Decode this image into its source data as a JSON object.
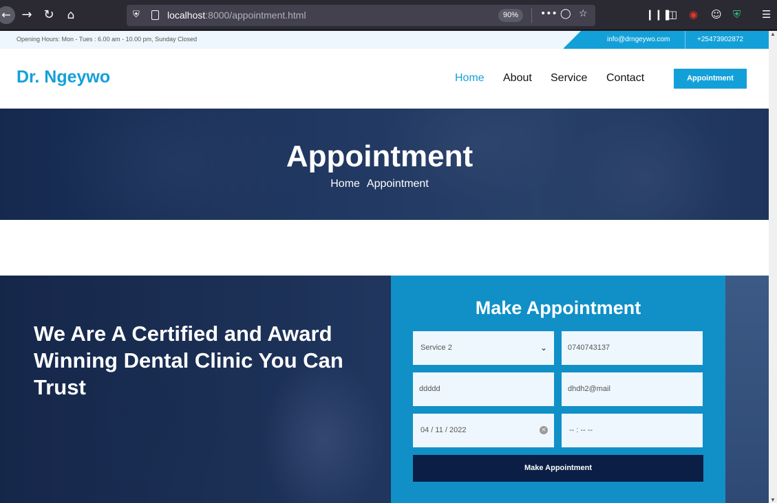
{
  "browser": {
    "url_host": "localhost",
    "url_rest": ":8000/appointment.html",
    "zoom": "90%"
  },
  "topbar": {
    "hours": "Opening Hours: Mon - Tues : 6.00 am - 10.00 pm, Sunday Closed",
    "email": "info@drngeywo.com",
    "phone": "+25473902872"
  },
  "header": {
    "logo": "Dr. Ngeywo",
    "nav": [
      "Home",
      "About",
      "Service",
      "Contact"
    ],
    "appointment_button": "Appointment"
  },
  "hero": {
    "title": "Appointment",
    "breadcrumb": [
      "Home",
      "Appointment"
    ]
  },
  "about": {
    "heading": "We Are A Certified and Award Winning Dental Clinic You Can Trust"
  },
  "form": {
    "title": "Make Appointment",
    "service": "Service 2",
    "phone": "0740743137",
    "name": "ddddd",
    "email": "dhdh2@mail",
    "date": "04 / 11 / 2022",
    "time": "-- : --   --",
    "submit": "Make Appointment"
  },
  "colors": {
    "accent": "#13a0d9",
    "form_panel": "#1090c7",
    "submit": "#0b1e45"
  }
}
